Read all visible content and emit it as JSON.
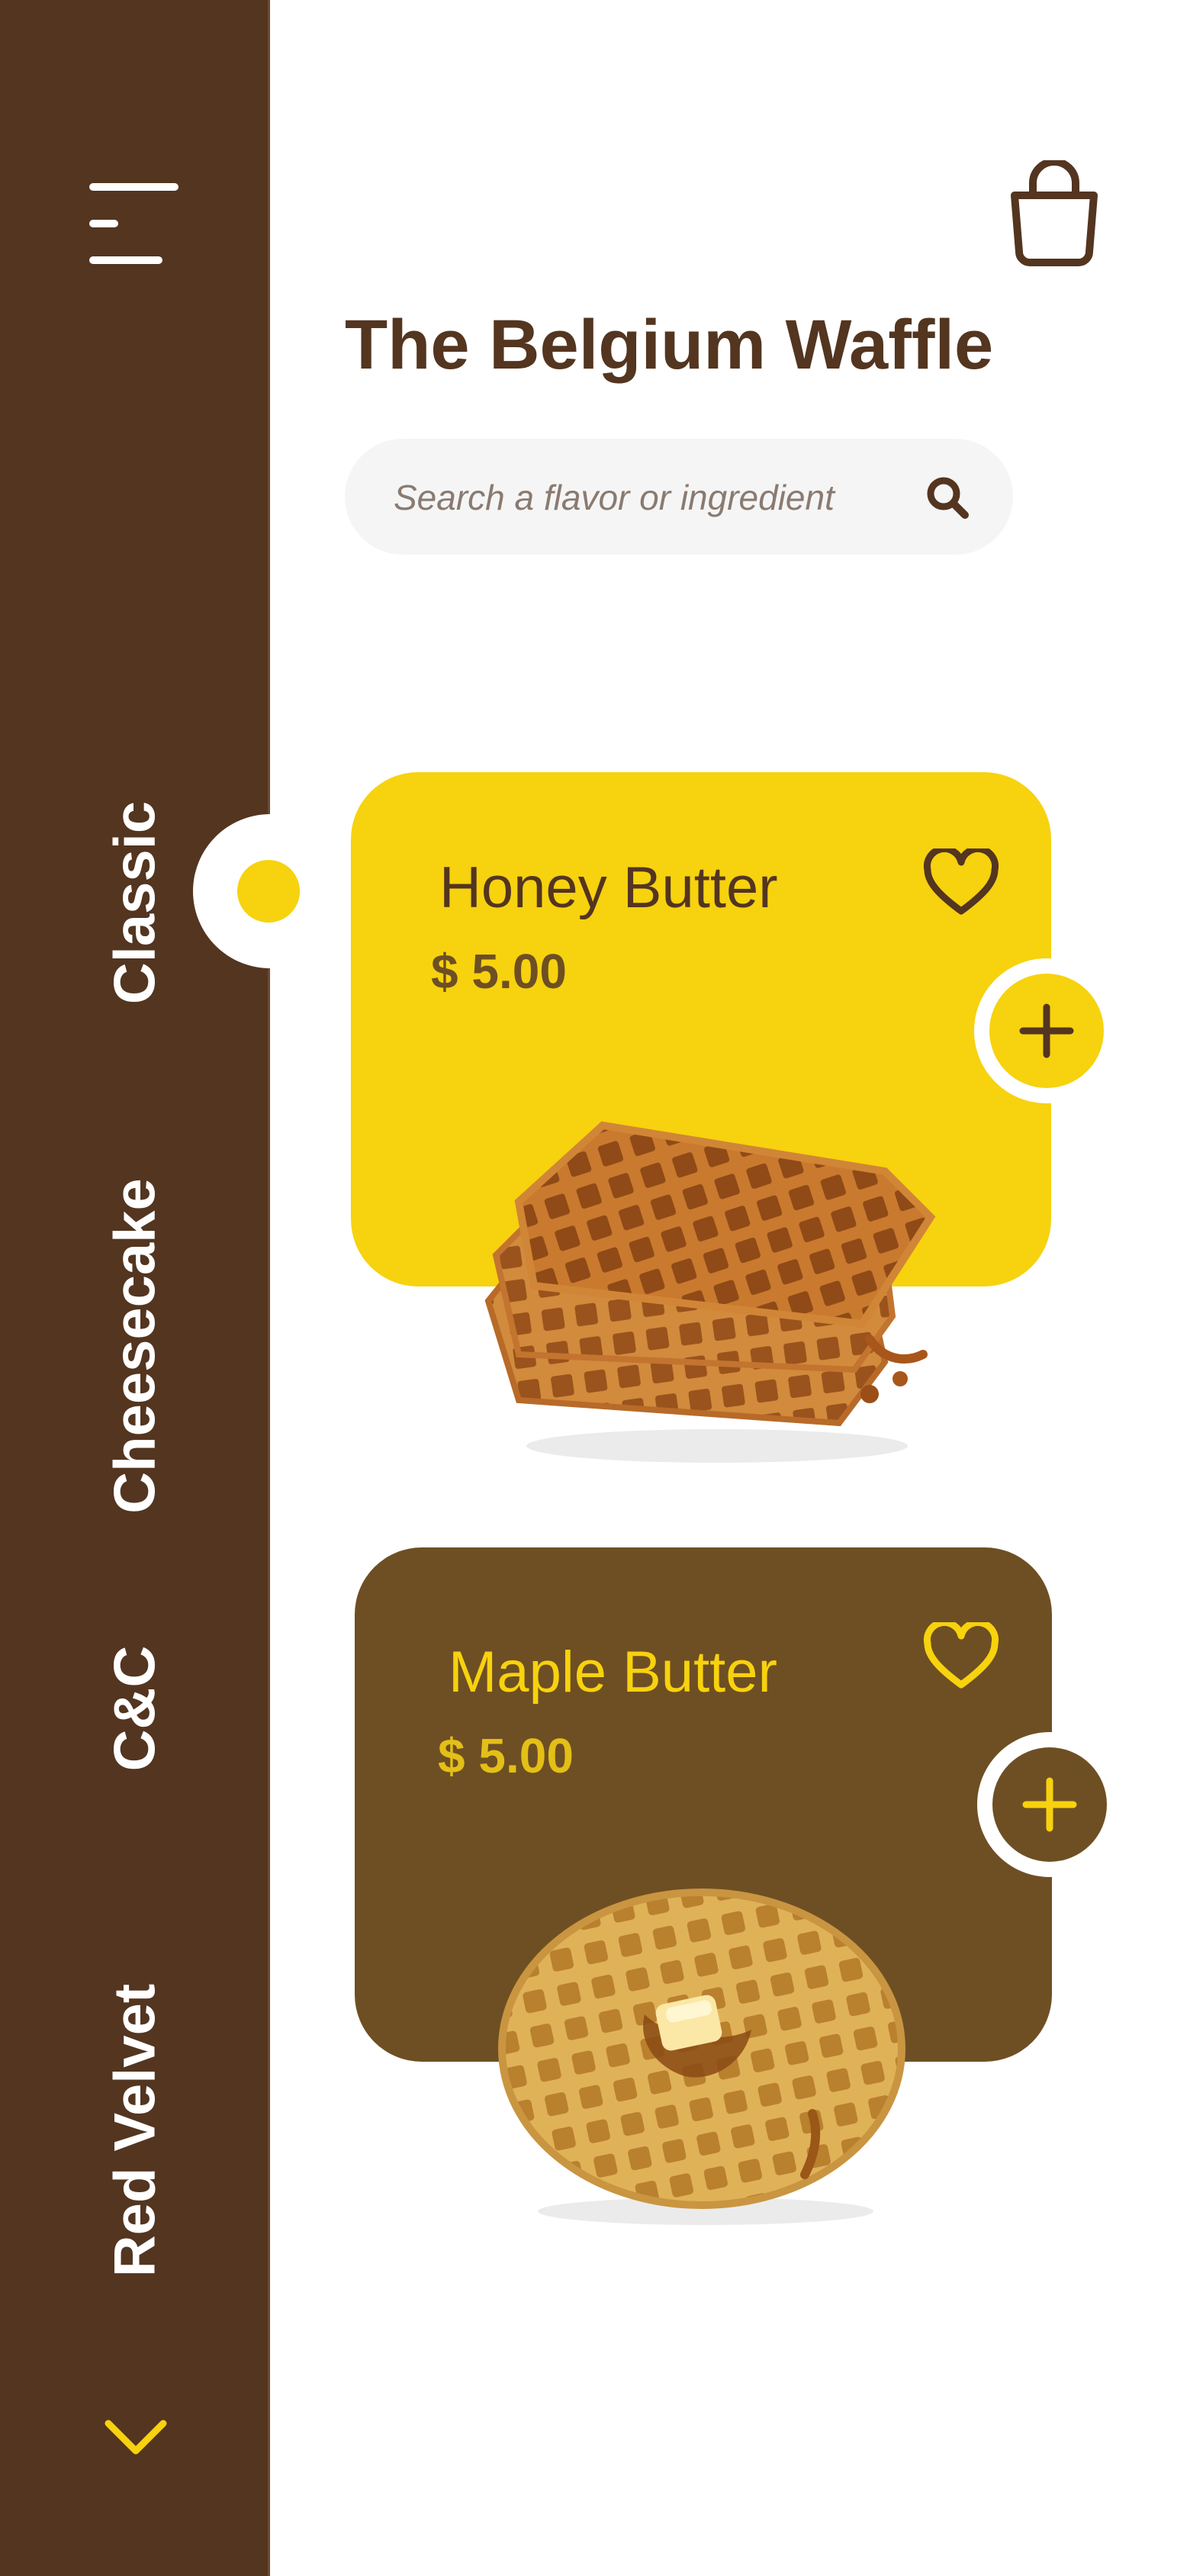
{
  "app": {
    "title": "The Belgium Waffle"
  },
  "search": {
    "placeholder": "Search a flavor or ingredient"
  },
  "sidebar": {
    "categories": [
      {
        "label": "Classic",
        "selected": true
      },
      {
        "label": "Cheesecake",
        "selected": false
      },
      {
        "label": "C&C",
        "selected": false
      },
      {
        "label": "Red Velvet",
        "selected": false
      }
    ]
  },
  "products": [
    {
      "name": "Honey Butter",
      "price": "$ 5.00",
      "card_color": "#f7d20e"
    },
    {
      "name": "Maple Butter",
      "price": "$ 5.00",
      "card_color": "#6e4f23"
    }
  ],
  "colors": {
    "sidebar": "#533520",
    "accent_yellow": "#f7d20e",
    "card_brown": "#6e4f23",
    "text_brown": "#533520"
  },
  "icons": {
    "menu": "hamburger-menu-icon",
    "cart": "shopping-bag-icon",
    "search": "search-icon",
    "favorite": "heart-icon",
    "add": "plus-icon",
    "more": "chevron-down-icon"
  }
}
